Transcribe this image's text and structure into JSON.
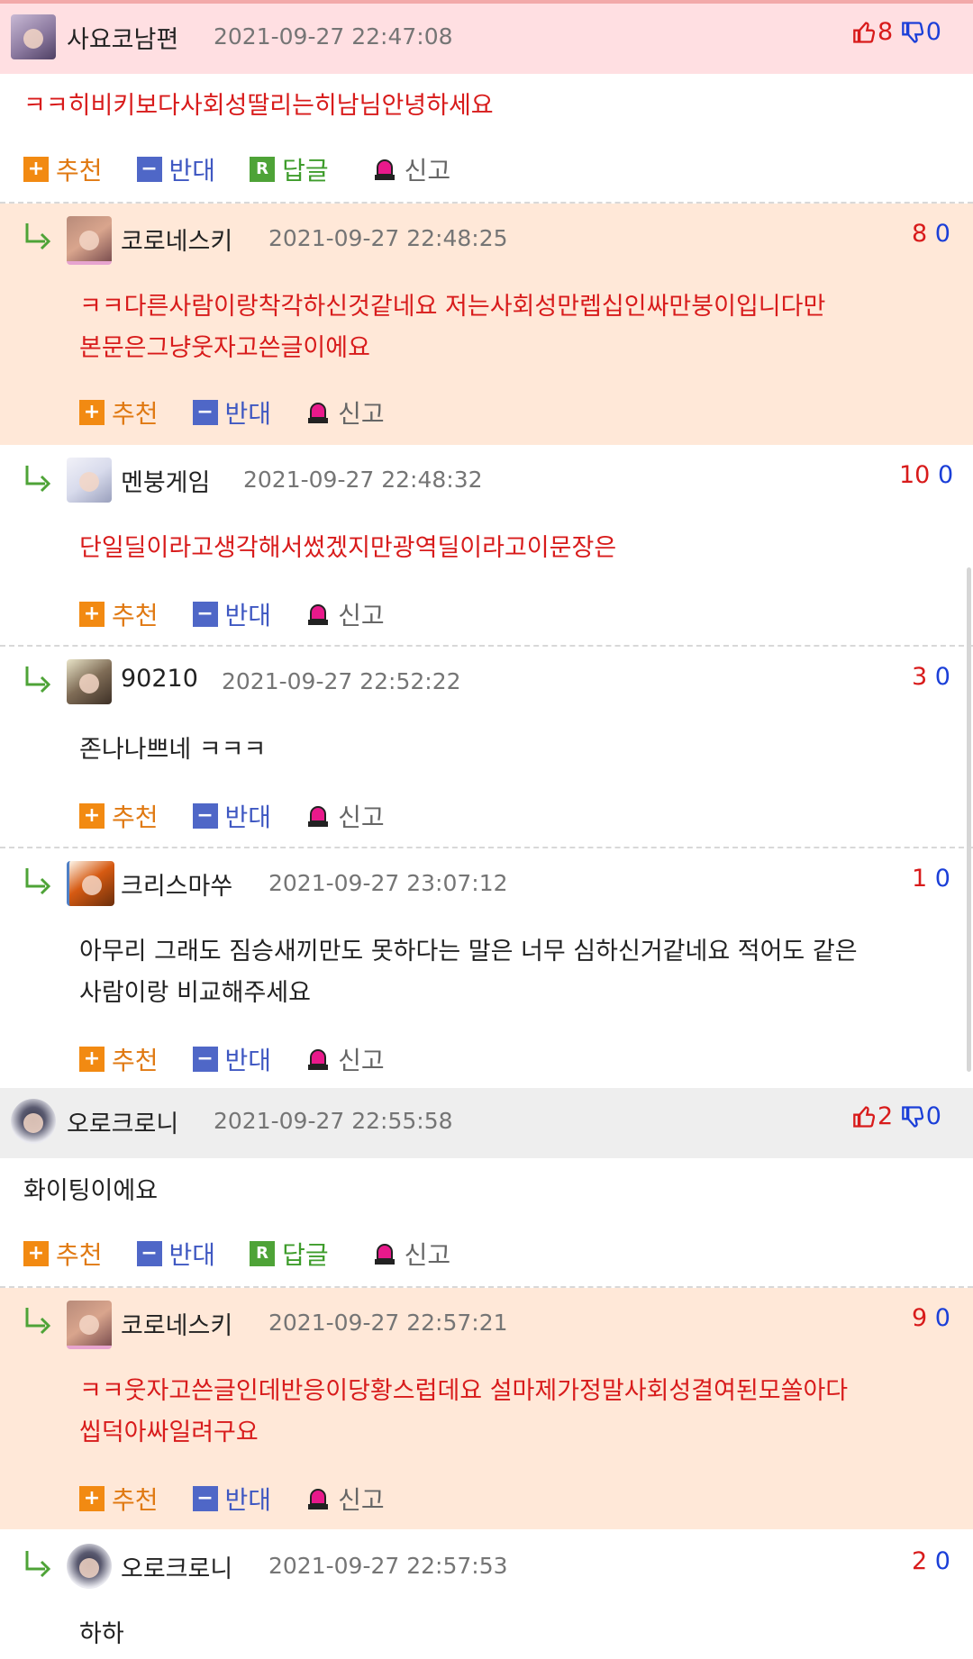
{
  "actions": {
    "recommend": "추천",
    "oppose": "반대",
    "answer": "답글",
    "report": "신고",
    "answer_icon_letter": "R"
  },
  "comments": [
    {
      "type": "top",
      "nickname": "사요코남편",
      "time": "2021-09-27 22:47:08",
      "up": "8",
      "down": "0",
      "lines": [
        "ㅋㅋ히비키보다사회성딸리는히남님안녕하세요"
      ],
      "text_color": "red",
      "avatar": "anime-girl-avatar"
    },
    {
      "type": "reply",
      "nickname": "코로네스키",
      "time": "2021-09-27 22:48:25",
      "up": "8",
      "down": "0",
      "lines": [
        "ㅋㅋ다른사람이랑착각하신것같네요 저는사회성만렙십인싸만붕이입니다만",
        "본문은그냥웃자고쓴글이에요"
      ],
      "text_color": "red",
      "avatar": "brown-hair-avatar"
    },
    {
      "type": "reply",
      "nickname": "멘붕게임",
      "time": "2021-09-27 22:48:32",
      "up": "10",
      "down": "0",
      "lines": [
        "단일딜이라고생각해서썼겠지만광역딜이라고이문장은"
      ],
      "text_color": "red",
      "avatar": "white-hair-avatar"
    },
    {
      "type": "reply",
      "nickname": "90210",
      "time": "2021-09-27 22:52:22",
      "up": "3",
      "down": "0",
      "lines": [
        "존나나쁘네 ㅋㅋㅋ"
      ],
      "text_color": "black",
      "avatar": "dark-hair-avatar"
    },
    {
      "type": "reply",
      "nickname": "크리스마쑤",
      "time": "2021-09-27 23:07:12",
      "up": "1",
      "down": "0",
      "lines": [
        "아무리 그래도 짐승새끼만도 못하다는 말은 너무 심하신거같네요 적어도 같은",
        "사람이랑 비교해주세요"
      ],
      "text_color": "black",
      "avatar": "pixel-art-avatar"
    },
    {
      "type": "top",
      "nickname": "오로크로니",
      "time": "2021-09-27 22:55:58",
      "up": "2",
      "down": "0",
      "lines": [
        "화이팅이에요"
      ],
      "text_color": "black",
      "avatar": "chibi-avatar"
    },
    {
      "type": "reply",
      "nickname": "코로네스키",
      "time": "2021-09-27 22:57:21",
      "up": "9",
      "down": "0",
      "lines": [
        "ㅋㅋ웃자고쓴글인데반응이당황스럽데요 설마제가정말사회성결여된모쏠아다",
        "씹덕아싸일려구요"
      ],
      "text_color": "red",
      "avatar": "brown-hair-avatar"
    },
    {
      "type": "reply",
      "nickname": "오로크로니",
      "time": "2021-09-27 22:57:53",
      "up": "2",
      "down": "0",
      "lines": [
        "하하"
      ],
      "text_color": "black",
      "avatar": "chibi-avatar"
    }
  ]
}
